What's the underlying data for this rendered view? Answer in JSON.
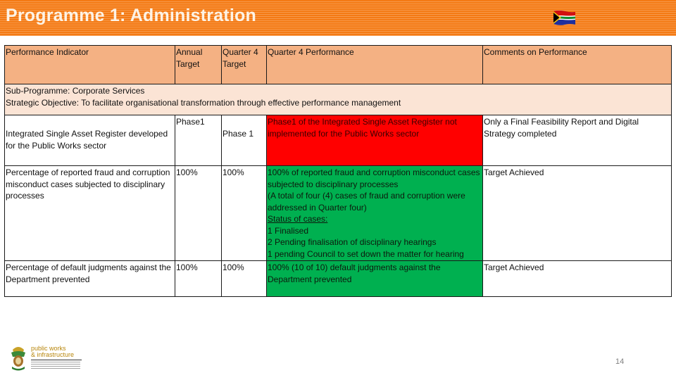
{
  "slide": {
    "title": "Programme 1: Administration",
    "flag_icon": "south-africa-flag-icon",
    "page_number": "14"
  },
  "table": {
    "headers": {
      "indicator": "Performance Indicator",
      "annual_target": "Annual Target",
      "q4_target": "Quarter 4 Target",
      "q4_performance": "Quarter 4 Performance",
      "comments": "Comments on Performance"
    },
    "sub_programme": {
      "line1": "Sub-Programme: Corporate Services",
      "line2": "Strategic Objective: To facilitate organisational transformation through effective performance management"
    },
    "rows": [
      {
        "indicator": "Integrated Single Asset Register developed for the Public Works sector",
        "annual_target": "Phase1",
        "q4_target": "Phase 1",
        "q4_performance": "Phase1 of the Integrated Single Asset Register  not implemented for the Public Works sector",
        "status": "not-achieved",
        "status_color": "#ff0000",
        "comments": "Only a Final Feasibility Report and Digital Strategy completed"
      },
      {
        "indicator": "Percentage of reported fraud and corruption misconduct cases subjected to disciplinary processes",
        "annual_target": "100%",
        "q4_target": "100%",
        "q4_performance_lines": [
          "100% of reported fraud and corruption misconduct cases subjected to disciplinary processes",
          "(A total of four (4) cases of fraud and corruption were addressed in Quarter four)",
          "Status of cases:",
          "1 Finalised",
          "2 Pending finalisation of disciplinary hearings",
          "1 pending Council to set down the matter for hearing"
        ],
        "status": "achieved",
        "status_color": "#00b050",
        "comments": "Target Achieved"
      },
      {
        "indicator": "Percentage of default judgments against the Department prevented",
        "annual_target": "100%",
        "q4_target": "100%",
        "q4_performance": "100% (10 of 10) default judgments against the Department prevented",
        "status": "achieved",
        "status_color": "#00b050",
        "comments": "Target Achieved"
      }
    ]
  },
  "footer": {
    "logo_line1": "public works",
    "logo_line2": "& infrastructure"
  }
}
